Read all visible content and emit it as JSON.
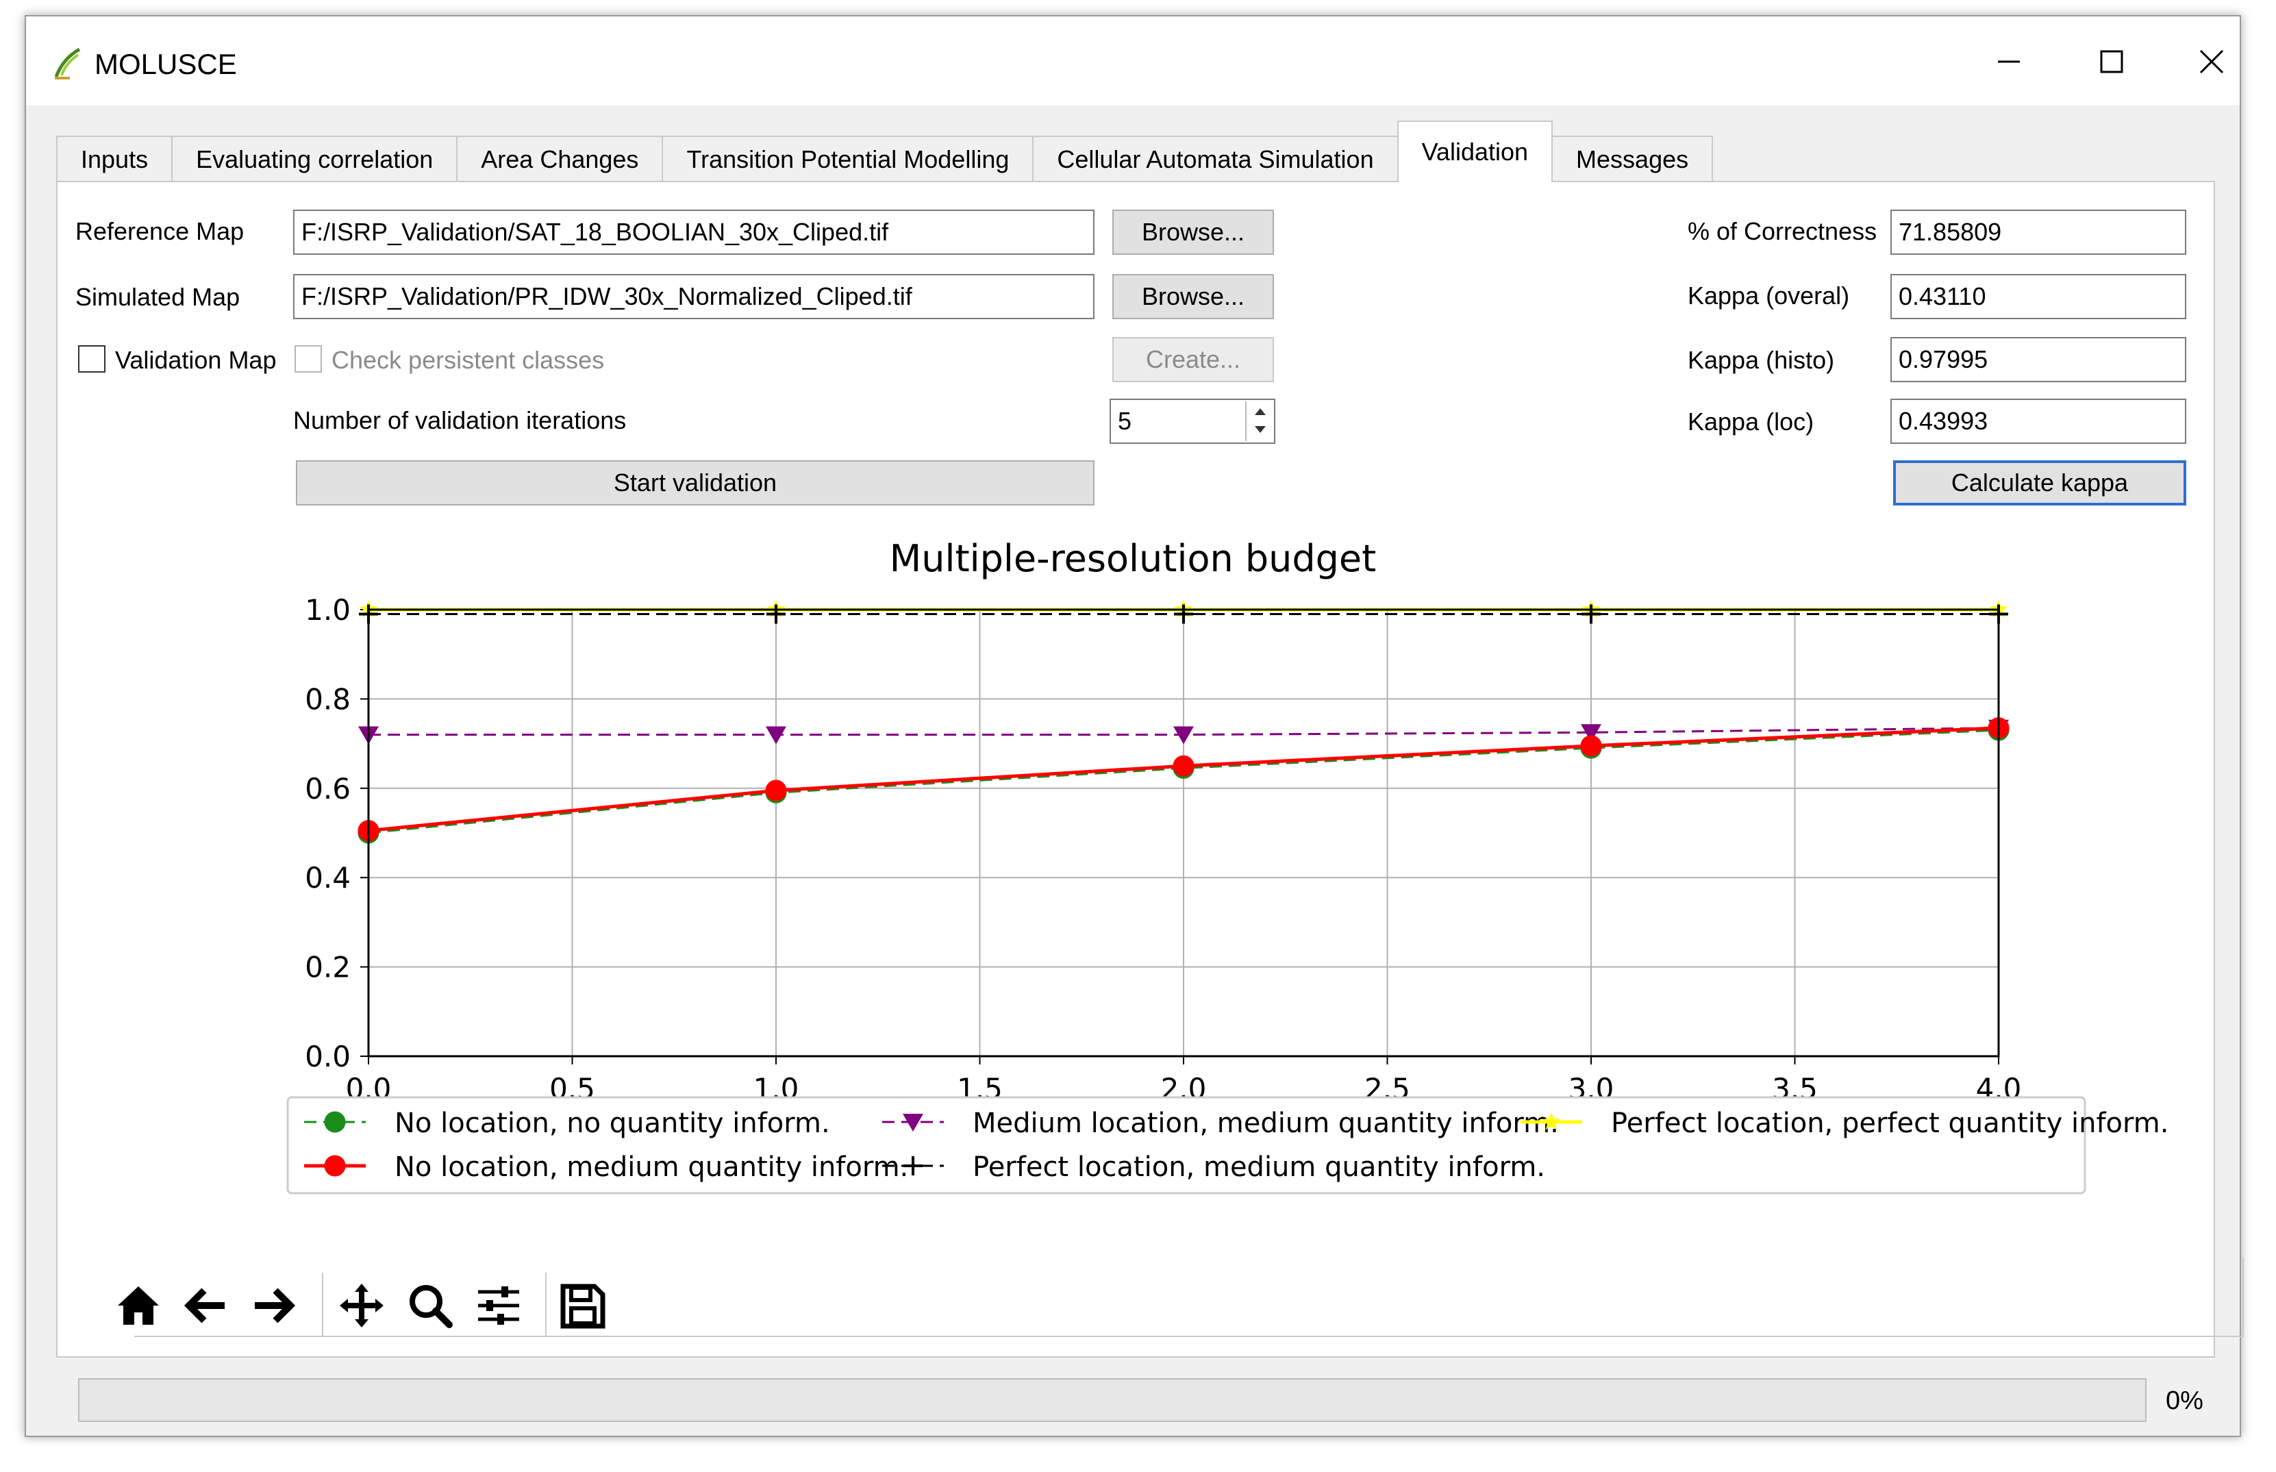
{
  "window": {
    "title": "MOLUSCE"
  },
  "tabs": [
    {
      "label": "Inputs",
      "active": false
    },
    {
      "label": "Evaluating correlation",
      "active": false
    },
    {
      "label": "Area Changes",
      "active": false
    },
    {
      "label": "Transition Potential Modelling",
      "active": false
    },
    {
      "label": "Cellular Automata Simulation",
      "active": false
    },
    {
      "label": "Validation",
      "active": true
    },
    {
      "label": "Messages",
      "active": false
    }
  ],
  "form": {
    "reference_map": {
      "label": "Reference Map",
      "value": "F:/ISRP_Validation/SAT_18_BOOLIAN_30x_Cliped.tif",
      "browse_label": "Browse..."
    },
    "simulated_map": {
      "label": "Simulated Map",
      "value": "F:/ISRP_Validation/PR_IDW_30x_Normalized_Cliped.tif",
      "browse_label": "Browse..."
    },
    "validation_map": {
      "label": "Validation Map",
      "checked": false
    },
    "check_persistent": {
      "label": "Check persistent classes",
      "checked": false,
      "enabled": false
    },
    "create_label": "Create...",
    "iterations": {
      "label": "Number of validation iterations",
      "value": "5"
    },
    "start_label": "Start validation"
  },
  "stats": {
    "correctness": {
      "label": "% of Correctness",
      "value": "71.85809"
    },
    "kappa_overal": {
      "label": "Kappa (overal)",
      "value": "0.43110"
    },
    "kappa_histo": {
      "label": "Kappa (histo)",
      "value": "0.97995"
    },
    "kappa_loc": {
      "label": "Kappa (loc)",
      "value": "0.43993"
    },
    "calculate_label": "Calculate kappa"
  },
  "toolbar": {
    "tools": [
      "home-icon",
      "back-arrow-icon",
      "forward-arrow-icon",
      "pan-icon",
      "zoom-icon",
      "configure-subplots-icon",
      "save-icon"
    ]
  },
  "progress": {
    "value": 0,
    "text": "0%"
  },
  "colors": {
    "green": "#1a8c1a",
    "red": "#ff0000",
    "purple": "#800080",
    "black": "#000000",
    "yellow": "#ffff00",
    "focus": "#2f6fcf"
  },
  "chart_data": {
    "type": "line",
    "title": "Multiple-resolution budget",
    "xlabel": "",
    "ylabel": "",
    "xlim": [
      0.0,
      4.0
    ],
    "ylim": [
      0.0,
      1.0
    ],
    "xticks": [
      "0.0",
      "0.5",
      "1.0",
      "1.5",
      "2.0",
      "2.5",
      "3.0",
      "3.5",
      "4.0"
    ],
    "yticks": [
      "0.0",
      "0.2",
      "0.4",
      "0.6",
      "0.8",
      "1.0"
    ],
    "grid": true,
    "legend_position": "bottom",
    "x": [
      0,
      1,
      2,
      3,
      4
    ],
    "series": [
      {
        "name": "No location, no quantity inform.",
        "values": [
          0.5,
          0.59,
          0.645,
          0.69,
          0.73
        ],
        "color": "#1a8c1a",
        "dash": "dash",
        "marker": "circle"
      },
      {
        "name": "No location, medium quantity inform.",
        "values": [
          0.505,
          0.595,
          0.65,
          0.695,
          0.735
        ],
        "color": "#ff0000",
        "dash": "solid",
        "marker": "circle"
      },
      {
        "name": "Medium location, medium quantity inform.",
        "values": [
          0.72,
          0.72,
          0.72,
          0.725,
          0.735
        ],
        "color": "#800080",
        "dash": "dash",
        "marker": "triangle-down"
      },
      {
        "name": "Perfect location, medium quantity inform.",
        "values": [
          0.99,
          0.99,
          0.99,
          0.99,
          0.99
        ],
        "color": "#000000",
        "dash": "dash",
        "marker": "plus"
      },
      {
        "name": "Perfect location, perfect quantity inform.",
        "values": [
          1.0,
          1.0,
          1.0,
          1.0,
          1.0
        ],
        "color": "#ffff00",
        "dash": "solid",
        "marker": "star"
      }
    ]
  }
}
